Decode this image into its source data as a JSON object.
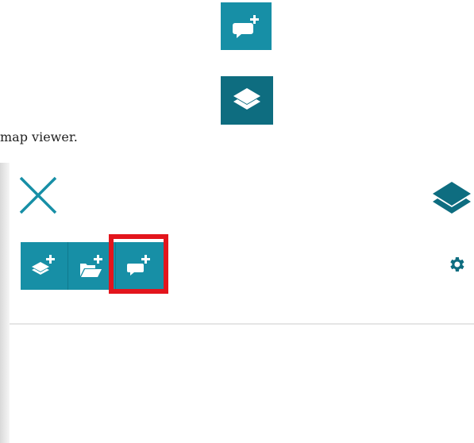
{
  "caption": {
    "text": "map viewer."
  },
  "colors": {
    "accent": "#178fa6",
    "accent_dark": "#0e6d80",
    "highlight": "#e3151c"
  },
  "top_icons": [
    {
      "name": "add-comment-icon"
    },
    {
      "name": "layers-icon"
    }
  ],
  "panel": {
    "close_icon": "close-icon",
    "layers_icon": "layers-icon",
    "toolbar": [
      {
        "name": "add-layer-button",
        "icon": "add-layer-icon"
      },
      {
        "name": "add-folder-button",
        "icon": "add-folder-icon"
      },
      {
        "name": "add-comment-button",
        "icon": "add-comment-icon",
        "highlighted": true
      }
    ],
    "settings_icon": "gear-icon"
  }
}
